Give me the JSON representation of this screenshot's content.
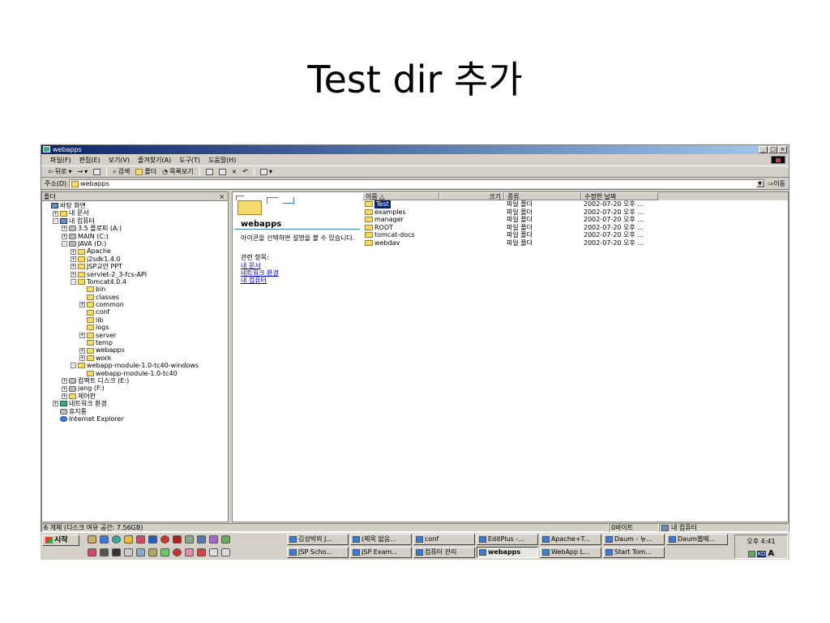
{
  "slide": {
    "title": "Test dir 추가"
  },
  "window": {
    "title": "webapps",
    "buttons": [
      "_",
      "□",
      "×"
    ]
  },
  "menu": [
    "파일(F)",
    "편집(E)",
    "보기(V)",
    "즐겨찾기(A)",
    "도구(T)",
    "도움말(H)"
  ],
  "toolbar": {
    "back": "뒤로",
    "forward": "→",
    "search": "검색",
    "folders": "폴더",
    "history": "목록보기",
    "delete": "×"
  },
  "address": {
    "label": "주소(D)",
    "value": "webapps",
    "go": "이동"
  },
  "folder_pane": {
    "header": "폴더",
    "close": "×",
    "tree": [
      {
        "label": "바탕 화면",
        "level": 0,
        "exp": "",
        "icon": "pc"
      },
      {
        "label": "내 문서",
        "level": 1,
        "exp": "+",
        "icon": "folder"
      },
      {
        "label": "내 컴퓨터",
        "level": 1,
        "exp": "-",
        "icon": "pc"
      },
      {
        "label": "3.5 플로피 (A:)",
        "level": 2,
        "exp": "+",
        "icon": "drive"
      },
      {
        "label": "MAIN (C:)",
        "level": 2,
        "exp": "+",
        "icon": "drive"
      },
      {
        "label": "JAVA (D:)",
        "level": 2,
        "exp": "-",
        "icon": "drive"
      },
      {
        "label": "Apache",
        "level": 3,
        "exp": "+",
        "icon": "folder"
      },
      {
        "label": "j2sdk1.4.0",
        "level": 3,
        "exp": "+",
        "icon": "folder"
      },
      {
        "label": "JSP교안 PPT",
        "level": 3,
        "exp": "+",
        "icon": "folder"
      },
      {
        "label": "servlet-2_3-fcs-API",
        "level": 3,
        "exp": "+",
        "icon": "folder"
      },
      {
        "label": "Tomcat4.0.4",
        "level": 3,
        "exp": "-",
        "icon": "folder"
      },
      {
        "label": "bin",
        "level": 4,
        "exp": "",
        "icon": "folder"
      },
      {
        "label": "classes",
        "level": 4,
        "exp": "",
        "icon": "folder"
      },
      {
        "label": "common",
        "level": 4,
        "exp": "+",
        "icon": "folder"
      },
      {
        "label": "conf",
        "level": 4,
        "exp": "",
        "icon": "folder"
      },
      {
        "label": "lib",
        "level": 4,
        "exp": "",
        "icon": "folder"
      },
      {
        "label": "logs",
        "level": 4,
        "exp": "",
        "icon": "folder"
      },
      {
        "label": "server",
        "level": 4,
        "exp": "+",
        "icon": "folder"
      },
      {
        "label": "temp",
        "level": 4,
        "exp": "",
        "icon": "folder"
      },
      {
        "label": "webapps",
        "level": 4,
        "exp": "+",
        "icon": "folder"
      },
      {
        "label": "work",
        "level": 4,
        "exp": "+",
        "icon": "folder"
      },
      {
        "label": "webapp-module-1.0-tc40-windows",
        "level": 3,
        "exp": "-",
        "icon": "folder"
      },
      {
        "label": "webapp-module-1.0-tc40",
        "level": 4,
        "exp": "",
        "icon": "folder"
      },
      {
        "label": "컴팩트 디스크 (E:)",
        "level": 2,
        "exp": "+",
        "icon": "drive"
      },
      {
        "label": "jang (F:)",
        "level": 2,
        "exp": "+",
        "icon": "drive"
      },
      {
        "label": "제어판",
        "level": 2,
        "exp": "+",
        "icon": "folder"
      },
      {
        "label": "네트워크 환경",
        "level": 1,
        "exp": "+",
        "icon": "net"
      },
      {
        "label": "휴지통",
        "level": 1,
        "exp": "",
        "icon": "drive"
      },
      {
        "label": "Internet Explorer",
        "level": 1,
        "exp": "",
        "icon": "ie"
      }
    ]
  },
  "web_view": {
    "folder_name": "webapps",
    "description": "아이콘을 선택하면 설명을 볼 수 있습니다.",
    "related": "관련 항목:",
    "links": [
      "내 문서",
      "네트워크 환경",
      "내 컴퓨터"
    ]
  },
  "list": {
    "columns": [
      "이름 △",
      "크기",
      "종류",
      "수정한 날짜"
    ],
    "rows": [
      {
        "name": "Test",
        "size": "",
        "type": "파일 폴더",
        "date": "2002-07-20 오후 ...",
        "selected": true
      },
      {
        "name": "examples",
        "size": "",
        "type": "파일 폴더",
        "date": "2002-07-20 오후 ...",
        "selected": false
      },
      {
        "name": "manager",
        "size": "",
        "type": "파일 폴더",
        "date": "2002-07-20 오후 ...",
        "selected": false
      },
      {
        "name": "ROOT",
        "size": "",
        "type": "파일 폴더",
        "date": "2002-07-20 오후 ...",
        "selected": false
      },
      {
        "name": "tomcat-docs",
        "size": "",
        "type": "파일 폴더",
        "date": "2002-07-20 오후 ...",
        "selected": false
      },
      {
        "name": "webdav",
        "size": "",
        "type": "파일 폴더",
        "date": "2002-07-20 오후 ...",
        "selected": false
      }
    ]
  },
  "status": {
    "count": "6 개체 (디스크 여유 공간: 7.56GB)",
    "size": "0바이트",
    "location": "내 컴퓨터"
  },
  "taskbar": {
    "start": "시작",
    "row1": [
      "김성박의 J...",
      "(제목 없음...",
      "conf",
      "EditPlus -...",
      "Apache+T...",
      "Daum - 뉴...",
      "Daum웹메..."
    ],
    "row2": [
      "JSP Scho...",
      "JSP Exam...",
      "컴퓨터 관리",
      "webapps",
      "WebApp L...",
      "Start Tom..."
    ],
    "active": "webapps",
    "clock": "오후 4:41",
    "ime_lang": "KO",
    "ime_mode": "A"
  },
  "colors": {
    "titlebar": "#0a246a",
    "selection": "#0a246a",
    "link": "#0000cc",
    "folder": "#f4d96b"
  }
}
